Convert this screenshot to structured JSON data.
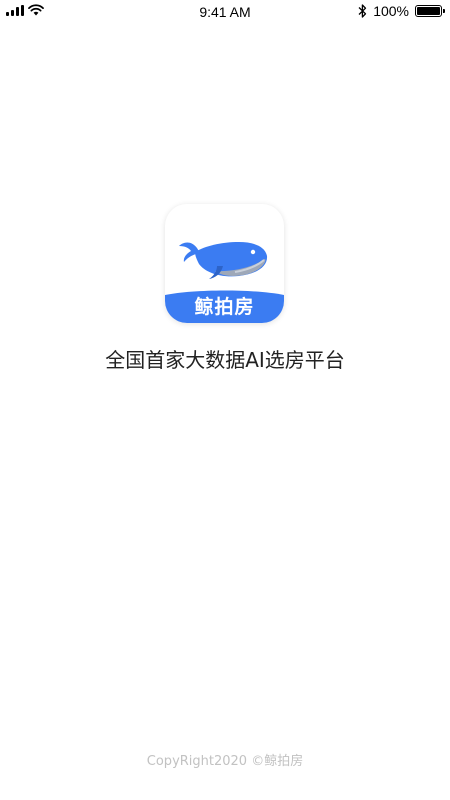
{
  "status_bar": {
    "time": "9:41 AM",
    "battery_percent": "100%",
    "battery_level": 1.0,
    "signal_icon": "cellular-signal-icon",
    "wifi_icon": "wifi-icon",
    "bluetooth_icon": "bluetooth-icon"
  },
  "app_icon": {
    "label": "鲸拍房",
    "icon": "whale-icon",
    "accent_color": "#3b7cf2"
  },
  "tagline": "全国首家大数据AI选房平台",
  "footer": {
    "copyright": "CopyRight2020  ©鲸拍房"
  }
}
